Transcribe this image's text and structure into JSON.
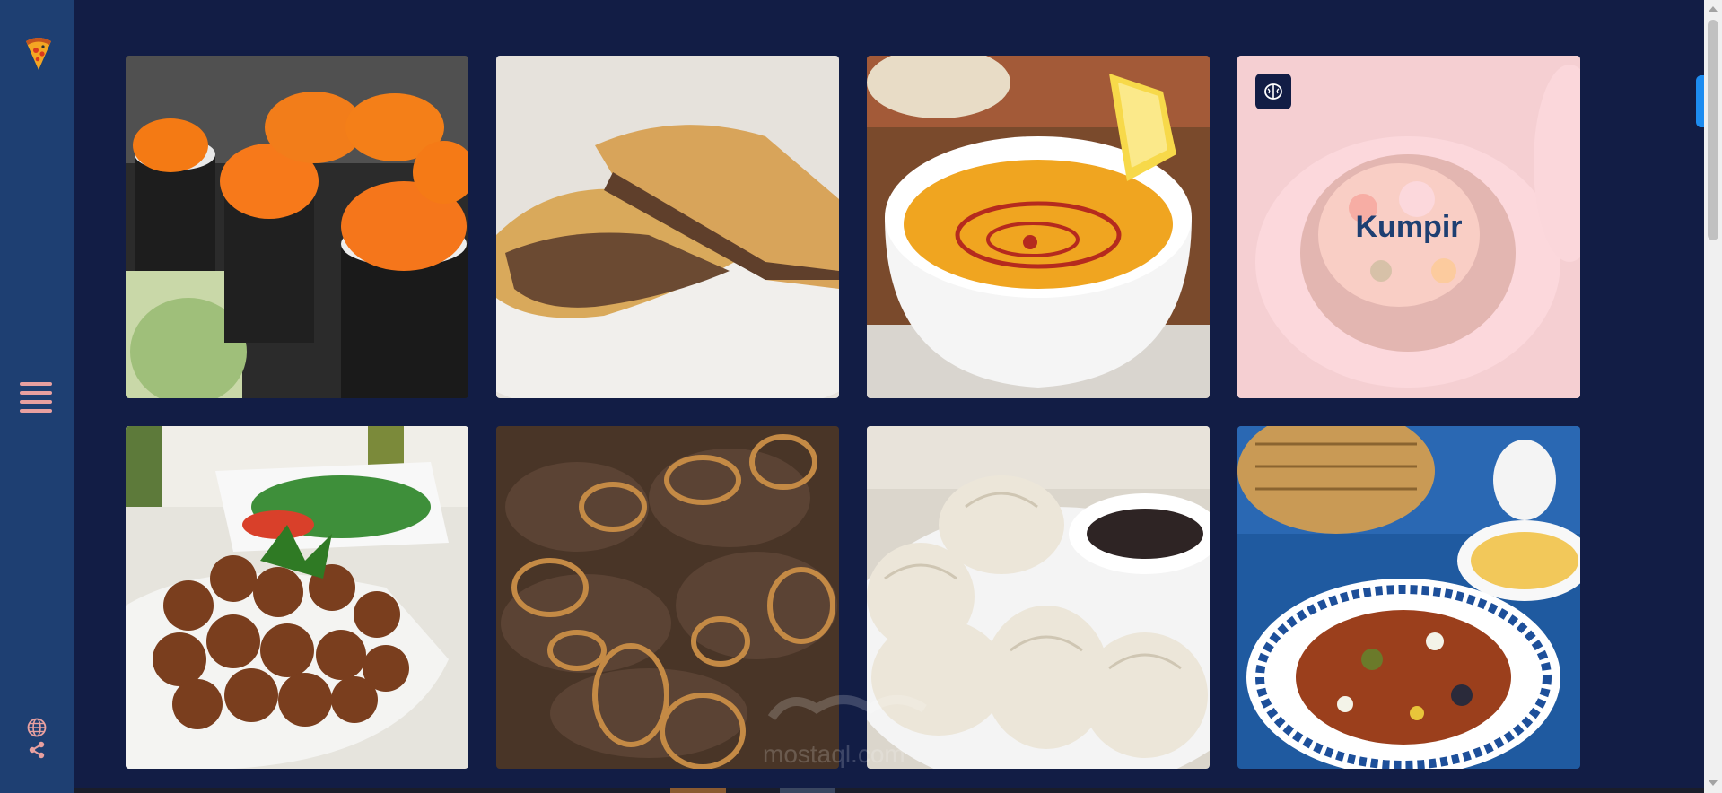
{
  "sidebar": {
    "logo_icon": "pizza-slice-icon",
    "menu_icon": "hamburger-menu-icon",
    "globe_icon": "globe-icon",
    "share_icon": "share-icon",
    "accent_color": "#e8a0a0"
  },
  "grid": {
    "cards": [
      {
        "label": "",
        "image": "sushi-rolls"
      },
      {
        "label": "",
        "image": "meat-borek"
      },
      {
        "label": "",
        "image": "lentil-soup"
      },
      {
        "label": "Kumpir",
        "image": "kumpir",
        "state": "hover",
        "badge_icon": "brain-icon"
      },
      {
        "label": "",
        "image": "falafel"
      },
      {
        "label": "",
        "image": "liver-onions"
      },
      {
        "label": "",
        "image": "dumplings"
      },
      {
        "label": "",
        "image": "eggplant-dish"
      }
    ]
  },
  "watermark": {
    "text": "mostaql.com"
  },
  "colors": {
    "background": "#121d45",
    "sidebar": "#1e3f72",
    "overlay": "#ffcdd2",
    "label": "#1e3f72",
    "scroll_accent": "#1d8cf0"
  }
}
